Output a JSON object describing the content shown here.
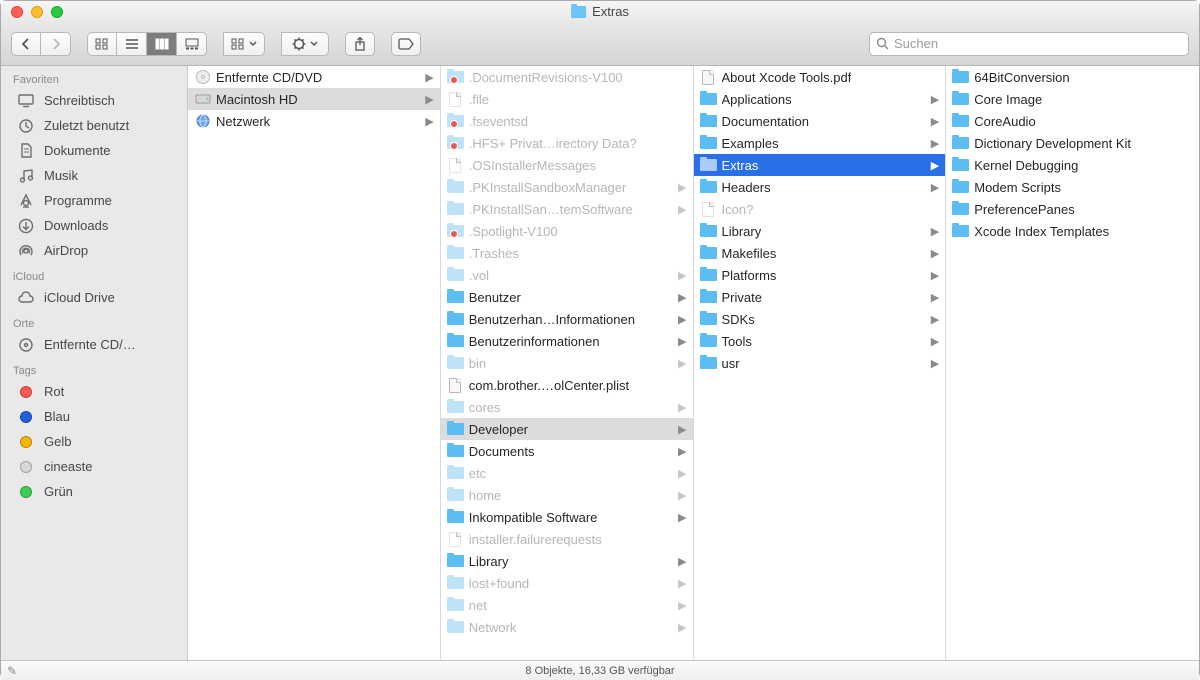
{
  "window": {
    "title": "Extras"
  },
  "search": {
    "placeholder": "Suchen"
  },
  "sidebar": {
    "sections": [
      {
        "header": "Favoriten",
        "items": [
          {
            "icon": "desktop",
            "label": "Schreibtisch"
          },
          {
            "icon": "clock",
            "label": "Zuletzt benutzt"
          },
          {
            "icon": "doc",
            "label": "Dokumente"
          },
          {
            "icon": "music",
            "label": "Musik"
          },
          {
            "icon": "apps",
            "label": "Programme"
          },
          {
            "icon": "down",
            "label": "Downloads"
          },
          {
            "icon": "airdrop",
            "label": "AirDrop"
          }
        ]
      },
      {
        "header": "iCloud",
        "items": [
          {
            "icon": "cloud",
            "label": "iCloud Drive"
          }
        ]
      },
      {
        "header": "Orte",
        "items": [
          {
            "icon": "disc",
            "label": "Entfernte CD/…"
          }
        ]
      },
      {
        "header": "Tags",
        "items": [
          {
            "icon": "tag",
            "color": "#ff5a52",
            "label": "Rot"
          },
          {
            "icon": "tag",
            "color": "#2160e0",
            "label": "Blau"
          },
          {
            "icon": "tag",
            "color": "#f7b500",
            "label": "Gelb"
          },
          {
            "icon": "tag",
            "color": "#d8d8d8",
            "label": "cineaste"
          },
          {
            "icon": "tag",
            "color": "#3bcd55",
            "label": "Grün"
          }
        ]
      }
    ]
  },
  "columns": [
    [
      {
        "icon": "disc",
        "label": "Entfernte CD/DVD",
        "arrow": true,
        "dim": false
      },
      {
        "icon": "hdd",
        "label": "Macintosh HD",
        "arrow": true,
        "selected": "gray"
      },
      {
        "icon": "globe",
        "label": "Netzwerk",
        "arrow": true
      }
    ],
    [
      {
        "icon": "folder",
        "dim": true,
        "label": ".DocumentRevisions-V100",
        "arrow": false,
        "noentry": true
      },
      {
        "icon": "file",
        "dim": true,
        "label": ".file"
      },
      {
        "icon": "folder",
        "dim": true,
        "label": ".fseventsd",
        "noentry": true
      },
      {
        "icon": "folder",
        "dim": true,
        "label": ".HFS+ Privat…irectory Data?",
        "noentry": true
      },
      {
        "icon": "file",
        "dim": true,
        "label": ".OSInstallerMessages"
      },
      {
        "icon": "folder",
        "dim": true,
        "label": ".PKInstallSandboxManager",
        "arrow": true
      },
      {
        "icon": "folder",
        "dim": true,
        "label": ".PKInstallSan…temSoftware",
        "arrow": true
      },
      {
        "icon": "folder",
        "dim": true,
        "label": ".Spotlight-V100",
        "noentry": true
      },
      {
        "icon": "folder",
        "dim": true,
        "label": ".Trashes"
      },
      {
        "icon": "folder",
        "dim": true,
        "label": ".vol",
        "arrow": true
      },
      {
        "icon": "folder",
        "label": "Benutzer",
        "arrow": true
      },
      {
        "icon": "folder",
        "label": "Benutzerhan…Informationen",
        "arrow": true
      },
      {
        "icon": "folder",
        "label": "Benutzerinformationen",
        "arrow": true
      },
      {
        "icon": "folder",
        "dim": true,
        "label": "bin",
        "arrow": true
      },
      {
        "icon": "fileicon",
        "label": "com.brother.…olCenter.plist"
      },
      {
        "icon": "folder",
        "dim": true,
        "label": "cores",
        "arrow": true
      },
      {
        "icon": "folder",
        "label": "Developer",
        "arrow": true,
        "selected": "gray"
      },
      {
        "icon": "folder",
        "label": "Documents",
        "arrow": true
      },
      {
        "icon": "folder",
        "dim": true,
        "label": "etc",
        "arrow": true
      },
      {
        "icon": "folder",
        "dim": true,
        "label": "home",
        "arrow": true
      },
      {
        "icon": "folder",
        "label": "Inkompatible Software",
        "arrow": true
      },
      {
        "icon": "file",
        "dim": true,
        "label": "installer.failurerequests"
      },
      {
        "icon": "folder",
        "label": "Library",
        "arrow": true
      },
      {
        "icon": "folder",
        "dim": true,
        "label": "lost+found",
        "arrow": true
      },
      {
        "icon": "folder",
        "dim": true,
        "label": "net",
        "arrow": true
      },
      {
        "icon": "folder",
        "dim": true,
        "label": "Network",
        "arrow": true
      }
    ],
    [
      {
        "icon": "fileicon",
        "label": "About Xcode Tools.pdf"
      },
      {
        "icon": "folder",
        "label": "Applications",
        "arrow": true
      },
      {
        "icon": "folder",
        "label": "Documentation",
        "arrow": true
      },
      {
        "icon": "folder",
        "label": "Examples",
        "arrow": true
      },
      {
        "icon": "folder",
        "label": "Extras",
        "arrow": true,
        "selected": "blue"
      },
      {
        "icon": "folder",
        "label": "Headers",
        "arrow": true
      },
      {
        "icon": "file",
        "dim": true,
        "label": "Icon?"
      },
      {
        "icon": "folder",
        "label": "Library",
        "arrow": true
      },
      {
        "icon": "folder",
        "label": "Makefiles",
        "arrow": true
      },
      {
        "icon": "folder",
        "label": "Platforms",
        "arrow": true
      },
      {
        "icon": "folder",
        "label": "Private",
        "arrow": true
      },
      {
        "icon": "folder",
        "label": "SDKs",
        "arrow": true
      },
      {
        "icon": "folder",
        "label": "Tools",
        "arrow": true
      },
      {
        "icon": "folder",
        "label": "usr",
        "arrow": true
      }
    ],
    [
      {
        "icon": "folder",
        "label": "64BitConversion"
      },
      {
        "icon": "folder",
        "label": "Core Image"
      },
      {
        "icon": "folder",
        "label": "CoreAudio"
      },
      {
        "icon": "folder",
        "label": "Dictionary Development Kit"
      },
      {
        "icon": "folder",
        "label": "Kernel Debugging"
      },
      {
        "icon": "folder",
        "label": "Modem Scripts"
      },
      {
        "icon": "folder",
        "label": "PreferencePanes"
      },
      {
        "icon": "folder",
        "label": "Xcode Index Templates"
      }
    ]
  ],
  "status": {
    "text": "8 Objekte, 16,33 GB verfügbar"
  }
}
